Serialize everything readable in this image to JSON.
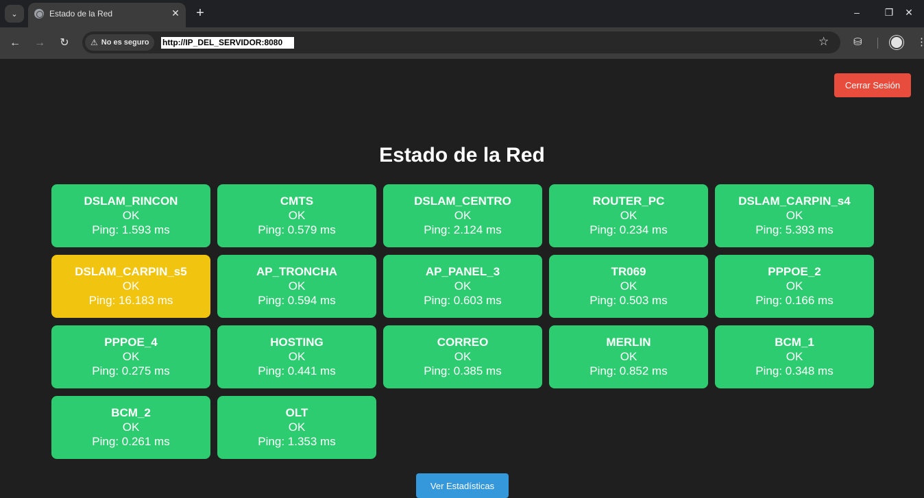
{
  "browser": {
    "tab_title": "Estado de la Red",
    "security_label": "No es seguro",
    "url": "http://IP_DEL_SERVIDOR:8080"
  },
  "page": {
    "logout_label": "Cerrar Sesión",
    "title": "Estado de la Red",
    "stats_label": "Ver Estadísticas"
  },
  "devices": [
    {
      "name": "DSLAM_RINCON",
      "status": "OK",
      "ping": "Ping: 1.593 ms",
      "color": "#2ecc71"
    },
    {
      "name": "CMTS",
      "status": "OK",
      "ping": "Ping: 0.579 ms",
      "color": "#2ecc71"
    },
    {
      "name": "DSLAM_CENTRO",
      "status": "OK",
      "ping": "Ping: 2.124 ms",
      "color": "#2ecc71"
    },
    {
      "name": "ROUTER_PC",
      "status": "OK",
      "ping": "Ping: 0.234 ms",
      "color": "#2ecc71"
    },
    {
      "name": "DSLAM_CARPIN_s4",
      "status": "OK",
      "ping": "Ping: 5.393 ms",
      "color": "#2ecc71"
    },
    {
      "name": "DSLAM_CARPIN_s5",
      "status": "OK",
      "ping": "Ping: 16.183 ms",
      "color": "#f1c40f"
    },
    {
      "name": "AP_TRONCHA",
      "status": "OK",
      "ping": "Ping: 0.594 ms",
      "color": "#2ecc71"
    },
    {
      "name": "AP_PANEL_3",
      "status": "OK",
      "ping": "Ping: 0.603 ms",
      "color": "#2ecc71"
    },
    {
      "name": "TR069",
      "status": "OK",
      "ping": "Ping: 0.503 ms",
      "color": "#2ecc71"
    },
    {
      "name": "PPPOE_2",
      "status": "OK",
      "ping": "Ping: 0.166 ms",
      "color": "#2ecc71"
    },
    {
      "name": "PPPOE_4",
      "status": "OK",
      "ping": "Ping: 0.275 ms",
      "color": "#2ecc71"
    },
    {
      "name": "HOSTING",
      "status": "OK",
      "ping": "Ping: 0.441 ms",
      "color": "#2ecc71"
    },
    {
      "name": "CORREO",
      "status": "OK",
      "ping": "Ping: 0.385 ms",
      "color": "#2ecc71"
    },
    {
      "name": "MERLIN",
      "status": "OK",
      "ping": "Ping: 0.852 ms",
      "color": "#2ecc71"
    },
    {
      "name": "BCM_1",
      "status": "OK",
      "ping": "Ping: 0.348 ms",
      "color": "#2ecc71"
    },
    {
      "name": "BCM_2",
      "status": "OK",
      "ping": "Ping: 0.261 ms",
      "color": "#2ecc71"
    },
    {
      "name": "OLT",
      "status": "OK",
      "ping": "Ping: 1.353 ms",
      "color": "#2ecc71"
    }
  ]
}
